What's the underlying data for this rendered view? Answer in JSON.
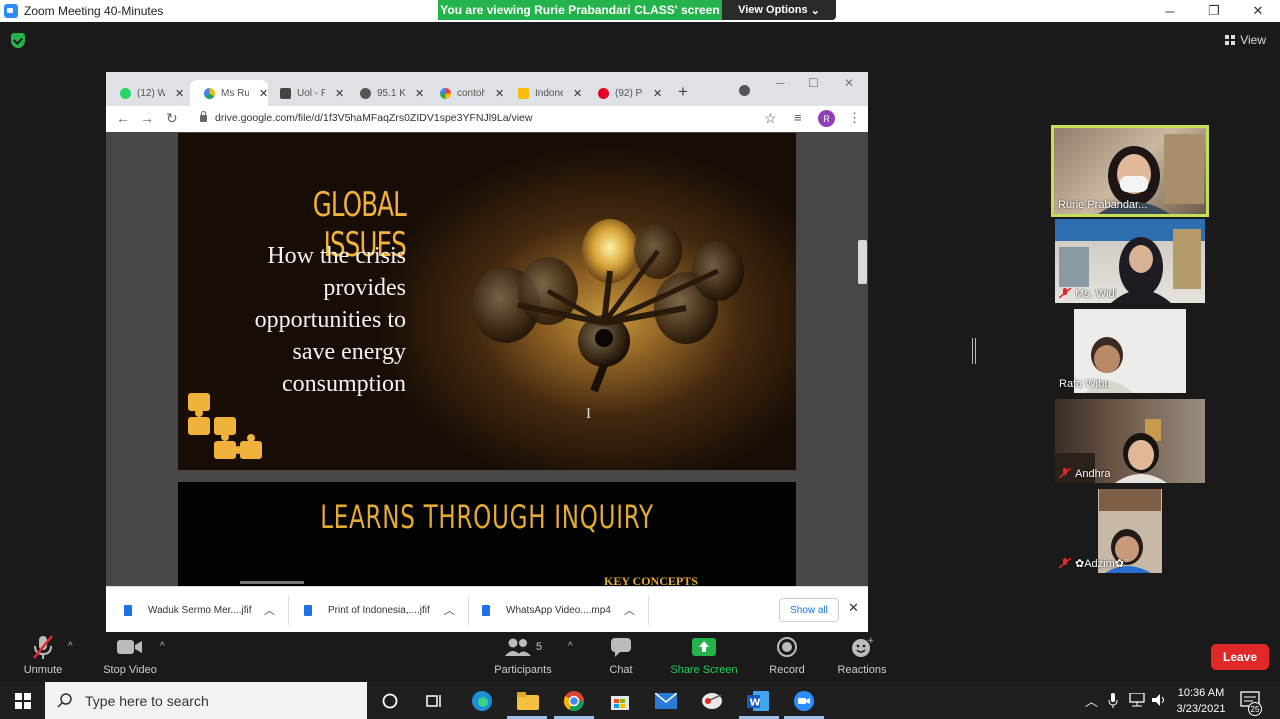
{
  "window": {
    "title": "Zoom Meeting 40-Minutes"
  },
  "share_banner": {
    "text": "You are viewing Rurie Prabandari CLASS' screen",
    "view_options": "View Options"
  },
  "top_right": {
    "view_label": "View"
  },
  "browser": {
    "tabs": [
      {
        "label": "(12) W",
        "favicon_color": "#25d366"
      },
      {
        "label": "Ms Ru",
        "favicon_color": "#1fa463",
        "active": true
      },
      {
        "label": "Uol - P",
        "favicon_color": "#444444"
      },
      {
        "label": "95.1 K",
        "favicon_color": "#555555"
      },
      {
        "label": "contoh",
        "favicon_color": "#4285f4"
      },
      {
        "label": "Indone",
        "favicon_color": "#fbbc05"
      },
      {
        "label": "(92) Pi",
        "favicon_color": "#e60023"
      }
    ],
    "url": "drive.google.com/file/d/1f3V5haMFaqZrs0ZIDV1spe3YFNJl9La/view",
    "profile_initial": "R",
    "downloads": [
      {
        "name": "Waduk Sermo Mer....jfif"
      },
      {
        "name": "Print of Indonesia,....jfif"
      },
      {
        "name": "WhatsApp Video....mp4"
      }
    ],
    "show_all": "Show all"
  },
  "slide1": {
    "title": "GLOBAL ISSUES",
    "subtitle_lines": [
      "How the crisis",
      "provides",
      "opportunities to",
      "save energy",
      "consumption"
    ]
  },
  "slide2": {
    "title": "LEARNS THROUGH INQUIRY",
    "key_concepts": "KEY CONCEPTS"
  },
  "participants": [
    {
      "name": "Rurie Prabandar...",
      "speaking": true
    },
    {
      "name": "Ms. Widi",
      "muted": true
    },
    {
      "name": "Rafa Wibu",
      "muted": false
    },
    {
      "name": "Andhra",
      "muted": true
    },
    {
      "name": "✿Adzim✿°",
      "muted": true
    }
  ],
  "controls": {
    "unmute": "Unmute",
    "stop_video": "Stop Video",
    "participants": "Participants",
    "participants_count": "5",
    "chat": "Chat",
    "share_screen": "Share Screen",
    "record": "Record",
    "reactions": "Reactions",
    "leave": "Leave"
  },
  "taskbar": {
    "search_placeholder": "Type here to search",
    "time": "10:36 AM",
    "date": "3/23/2021",
    "notification_count": "25"
  },
  "colors": {
    "zoom_blue": "#2d8cff",
    "share_green": "#24b24a",
    "leave_red": "#e02828",
    "speaker_border": "#c5e055"
  }
}
